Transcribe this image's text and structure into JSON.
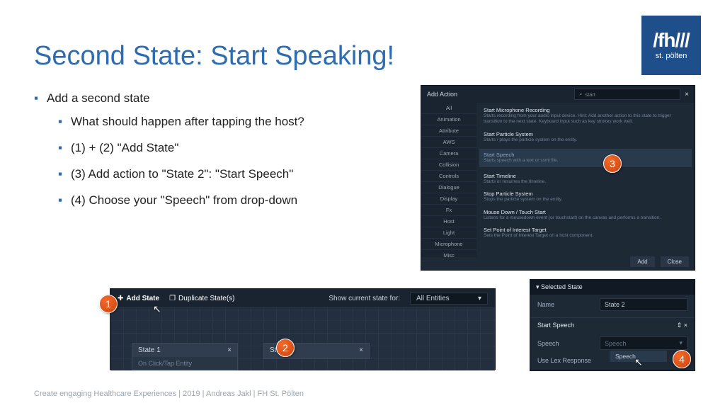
{
  "logo": {
    "top": "/fh///",
    "bot": "st. pölten"
  },
  "slide": {
    "title": "Second State: Start Speaking!",
    "bullets": {
      "main": "Add a second state",
      "sub": [
        "What should happen after tapping the host?",
        "(1) + (2) \"Add State\"",
        "(3) Add action to \"State 2\": \"Start Speech\"",
        "(4) Choose your \"Speech\" from drop-down"
      ]
    },
    "footer": "Create engaging Healthcare Experiences | 2019 | Andreas Jakl | FH St. Pölten"
  },
  "callouts": {
    "1": "1",
    "2": "2",
    "3": "3",
    "4": "4"
  },
  "panel1": {
    "add_state": "Add State",
    "dup": "Duplicate State(s)",
    "show_label": "Show current state for:",
    "show_val": "All Entities",
    "state1": {
      "name": "State 1",
      "sub": "On Click/Tap Entity"
    },
    "state2": {
      "name": "State 2"
    },
    "close": "×"
  },
  "panel2": {
    "title": "Add Action",
    "search": "start",
    "categories": [
      "All",
      "Animation",
      "Attribute",
      "AWS",
      "Camera",
      "Collision",
      "Controls",
      "Dialogue",
      "Display",
      "Fx",
      "Host",
      "Light",
      "Microphone",
      "Misc"
    ],
    "items": [
      {
        "t": "Start Microphone Recording",
        "d": "Starts recording from your audio input device. Hint: Add another action to this state to trigger transition to the next state. Keyboard input such as key strokes work well."
      },
      {
        "t": "Start Particle System",
        "d": "Starts / plays the particle system on the entity."
      },
      {
        "t": "Start Speech",
        "d": "Starts speech with a text or ssml file."
      },
      {
        "t": "Start Timeline",
        "d": "Starts or resumes the timeline."
      },
      {
        "t": "Stop Particle System",
        "d": "Stops the particle system on the entity."
      },
      {
        "t": "Mouse Down / Touch Start",
        "d": "Listens for a mousedown event (or touchstart) on the canvas and performs a transition."
      },
      {
        "t": "Set Point of Interest Target",
        "d": "Sets the Point of Interest Target on a host component."
      }
    ],
    "add": "Add",
    "close": "Close",
    "x": "×"
  },
  "panel3": {
    "header": "Selected State",
    "name_lbl": "Name",
    "name_val": "State 2",
    "section": "Start Speech",
    "speech_lbl": "Speech",
    "speech_val": "Speech",
    "lex_lbl": "Use Lex Response",
    "drop_opt": "Speech",
    "icons": "⇕ ×"
  }
}
